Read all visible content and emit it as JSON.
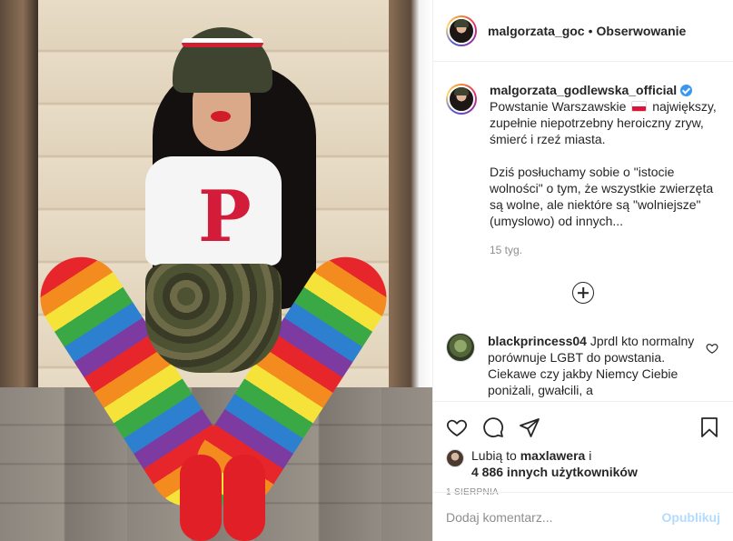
{
  "header": {
    "username": "malgorzata_goc",
    "separator": "•",
    "follow_label": "Obserwowanie"
  },
  "caption": {
    "author": "malgorzata_godlewska_official",
    "line1_before_flag": "Powstanie Warszawskie",
    "line1_after_flag": "największy, zupełnie niepotrzebny heroiczny zryw, śmierć i rzeź miasta.",
    "paragraph2": "Dziś posłuchamy sobie o \"istocie wolności\" o tym, że wszystkie zwierzęta są wolne, ale niektóre są \"wolniejsze\" (umyslowo) od innych...",
    "time": "15 tyg."
  },
  "comment": {
    "author": "blackprincess04",
    "text": "Jprdl kto normalny porównuje LGBT do powstania. Ciekawe czy jakby Niemcy Ciebie poniżali, gwałcili, a"
  },
  "likes": {
    "prefix": "Lubią to",
    "first_user": "maxlawera",
    "connector": "i",
    "others": "4 886 innych użytkowników"
  },
  "date": "1 SIERPNIA",
  "add_comment": {
    "placeholder": "Dodaj komentarz...",
    "publish_label": "Opublikuj"
  },
  "colors": {
    "accent_blue": "#3897f0",
    "publish_disabled": "#b3dbff",
    "text_primary": "#262626",
    "text_secondary": "#8e8e8e"
  }
}
